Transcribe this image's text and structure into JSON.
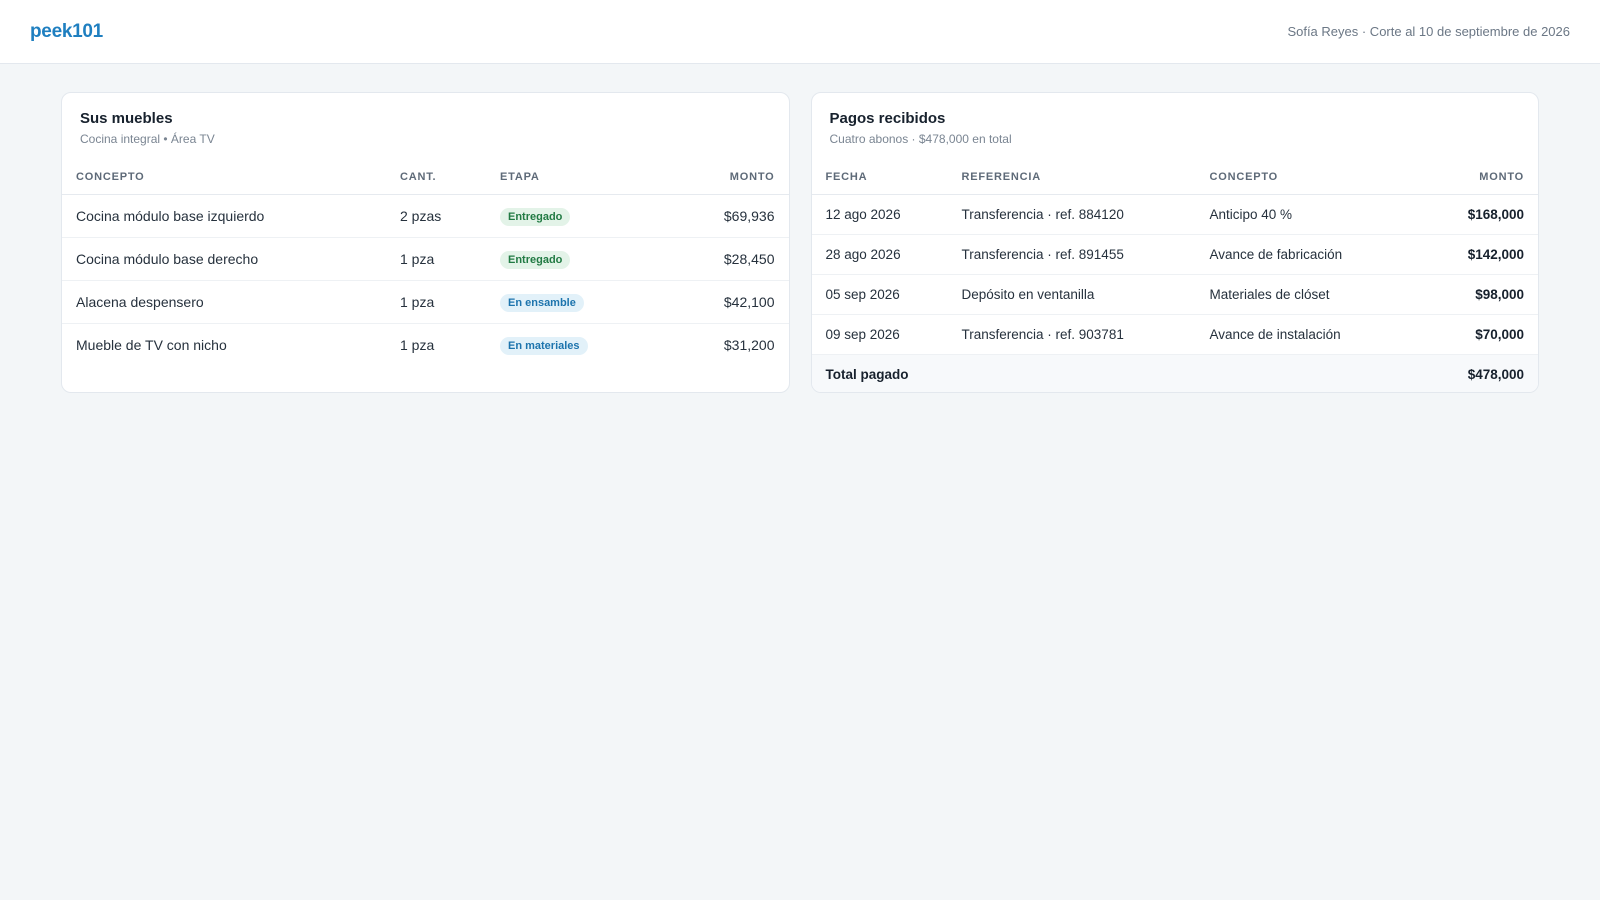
{
  "header": {
    "logo": "peek101",
    "meta": "Sofía Reyes · Corte al 10 de septiembre de 2026"
  },
  "furniture": {
    "title": "Sus muebles",
    "subtitle": "Cocina integral • Área TV",
    "columns": [
      "CONCEPTO",
      "CANT.",
      "ETAPA",
      "MONTO"
    ],
    "rows": [
      {
        "concept": "Cocina módulo base izquierdo",
        "qty": "2 pzas",
        "stage": "Entregado",
        "stage_color": "#217a43",
        "amount": "$69,936"
      },
      {
        "concept": "Cocina módulo base derecho",
        "qty": "1 pza",
        "stage": "Entregado",
        "stage_color": "#217a43",
        "amount": "$28,450"
      },
      {
        "concept": "Alacena despensero",
        "qty": "1 pza",
        "stage": "En ensamble",
        "stage_color": "#1d74ad",
        "amount": "$42,100"
      },
      {
        "concept": "Mueble de TV con nicho",
        "qty": "1 pza",
        "stage": "En materiales",
        "stage_color": "#1d74ad",
        "amount": "$31,200"
      }
    ]
  },
  "payments": {
    "title": "Pagos recibidos",
    "subtitle": "Cuatro abonos · $478,000 en total",
    "columns": [
      "FECHA",
      "REFERENCIA",
      "CONCEPTO",
      "MONTO"
    ],
    "rows": [
      {
        "date": "12 ago 2026",
        "reference": "Transferencia · ref. 884120",
        "concept": "Anticipo 40 %",
        "amount": "$168,000"
      },
      {
        "date": "28 ago 2026",
        "reference": "Transferencia · ref. 891455",
        "concept": "Avance de fabricación",
        "amount": "$142,000"
      },
      {
        "date": "05 sep 2026",
        "reference": "Depósito en ventanilla",
        "concept": "Materiales de clóset",
        "amount": "$98,000"
      },
      {
        "date": "09 sep 2026",
        "reference": "Transferencia · ref. 903781",
        "concept": "Avance de instalación",
        "amount": "$70,000"
      }
    ],
    "total_label": "Total pagado",
    "total_amount": "$478,000"
  },
  "colors": {
    "brand": "#1f7fc0",
    "badge_green_bg": "#e3f3e8",
    "badge_blue_bg": "#e2f1f9"
  }
}
